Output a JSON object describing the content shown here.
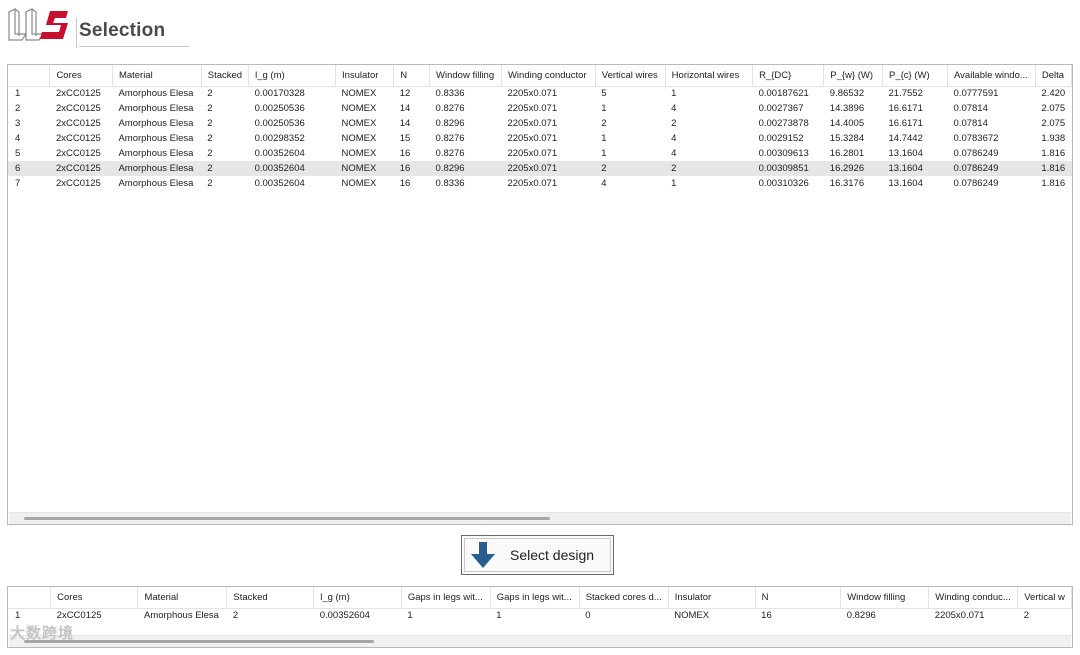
{
  "header": {
    "title": "Selection",
    "logo_text": "LLS"
  },
  "results_table": {
    "columns": [
      "",
      "Cores",
      "Material",
      "Stacked",
      "l_g (m)",
      "Insulator",
      "N",
      "Window filling",
      "Winding conductor",
      "Vertical wires",
      "Horizontal wires",
      "R_{DC}",
      "P_{w} (W)",
      "P_{c} (W)",
      "Available windo...",
      "Delta"
    ],
    "rows": [
      [
        "1",
        "2xCC0125",
        "Amorphous Elesa",
        "2",
        "0.00170328",
        "NOMEX",
        "12",
        "0.8336",
        "2205x0.071",
        "5",
        "1",
        "0.00187621",
        "9.86532",
        "21.7552",
        "0.0777591",
        "2.420"
      ],
      [
        "2",
        "2xCC0125",
        "Amorphous Elesa",
        "2",
        "0.00250536",
        "NOMEX",
        "14",
        "0.8276",
        "2205x0.071",
        "1",
        "4",
        "0.0027367",
        "14.3896",
        "16.6171",
        "0.07814",
        "2.075"
      ],
      [
        "3",
        "2xCC0125",
        "Amorphous Elesa",
        "2",
        "0.00250536",
        "NOMEX",
        "14",
        "0.8296",
        "2205x0.071",
        "2",
        "2",
        "0.00273878",
        "14.4005",
        "16.6171",
        "0.07814",
        "2.075"
      ],
      [
        "4",
        "2xCC0125",
        "Amorphous Elesa",
        "2",
        "0.00298352",
        "NOMEX",
        "15",
        "0.8276",
        "2205x0.071",
        "1",
        "4",
        "0.0029152",
        "15.3284",
        "14.7442",
        "0.0783672",
        "1.938"
      ],
      [
        "5",
        "2xCC0125",
        "Amorphous Elesa",
        "2",
        "0.00352604",
        "NOMEX",
        "16",
        "0.8276",
        "2205x0.071",
        "1",
        "4",
        "0.00309613",
        "16.2801",
        "13.1604",
        "0.0786249",
        "1.816"
      ],
      [
        "6",
        "2xCC0125",
        "Amorphous Elesa",
        "2",
        "0.00352604",
        "NOMEX",
        "16",
        "0.8296",
        "2205x0.071",
        "2",
        "2",
        "0.00309851",
        "16.2926",
        "13.1604",
        "0.0786249",
        "1.816"
      ],
      [
        "7",
        "2xCC0125",
        "Amorphous Elesa",
        "2",
        "0.00352604",
        "NOMEX",
        "16",
        "0.8336",
        "2205x0.071",
        "4",
        "1",
        "0.00310326",
        "16.3176",
        "13.1604",
        "0.0786249",
        "1.816"
      ]
    ],
    "selected_row": 6
  },
  "select_button": {
    "label": "Select design"
  },
  "selected_table": {
    "columns": [
      "",
      "Cores",
      "Material",
      "Stacked",
      "l_g (m)",
      "Gaps in legs wit...",
      "Gaps in legs wit...",
      "Stacked cores d...",
      "Insulator",
      "N",
      "Window filling",
      "Winding conduc...",
      "Vertical w"
    ],
    "rows": [
      [
        "1",
        "2xCC0125",
        "Amorphous Elesa",
        "2",
        "0.00352604",
        "1",
        "1",
        "0",
        "NOMEX",
        "16",
        "0.8296",
        "2205x0.071",
        "2"
      ]
    ]
  },
  "watermark": "大数跨境",
  "colors": {
    "brand_red": "#c8102e",
    "selected_row": "#e6e6e6",
    "icon_blue": "#2a5d8f"
  }
}
